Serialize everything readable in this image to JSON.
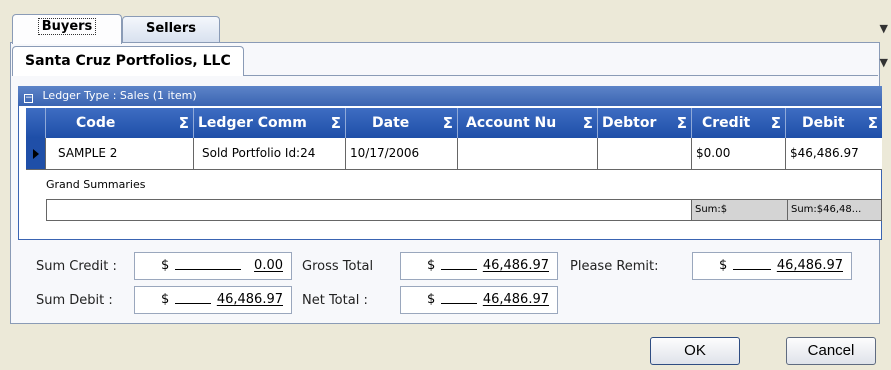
{
  "tabs": [
    {
      "label": "Buyers",
      "active": true
    },
    {
      "label": "Sellers",
      "active": false
    }
  ],
  "inner_tab": {
    "label": "Santa Cruz Portfolios, LLC"
  },
  "group_header": {
    "label": "Ledger Type : Sales (1 item)"
  },
  "grid": {
    "columns": [
      "Code",
      "Ledger Comm",
      "Date",
      "Account Nu",
      "Debtor",
      "Credit",
      "Debit"
    ],
    "row": {
      "code": "SAMPLE 2",
      "ledger_comment": "Sold Portfolio Id:24",
      "date": "10/17/2006",
      "account_number": "",
      "debtor": "",
      "credit": "$0.00",
      "debit": "$46,486.97"
    },
    "grand_summaries_label": "Grand Summaries",
    "sum_credit": "Sum:$",
    "sum_debit": "Sum:$46,48..."
  },
  "totals": {
    "sum_credit_label": "Sum Credit :",
    "sum_credit_dollar": "$",
    "sum_credit_value": "0.00",
    "sum_debit_label": "Sum Debit :",
    "sum_debit_dollar": "$",
    "sum_debit_value": "46,486.97",
    "gross_total_label": "Gross Total",
    "gross_total_dollar": "$",
    "gross_total_value": "46,486.97",
    "net_total_label": "Net Total :",
    "net_total_dollar": "$",
    "net_total_value": "46,486.97",
    "please_remit_label": "Please Remit:",
    "please_remit_dollar": "$",
    "please_remit_value": "46,486.97"
  },
  "buttons": {
    "ok": "OK",
    "cancel": "Cancel"
  },
  "icons": {
    "corner_menu": "dropdown-pin-icon",
    "sigma": "summary-sigma-icon",
    "row_selector": "row-pointer-icon",
    "collapse": "collapse-minus-icon"
  },
  "colors": {
    "header_blue": "#1e4fa8",
    "background": "#ece9d8"
  }
}
